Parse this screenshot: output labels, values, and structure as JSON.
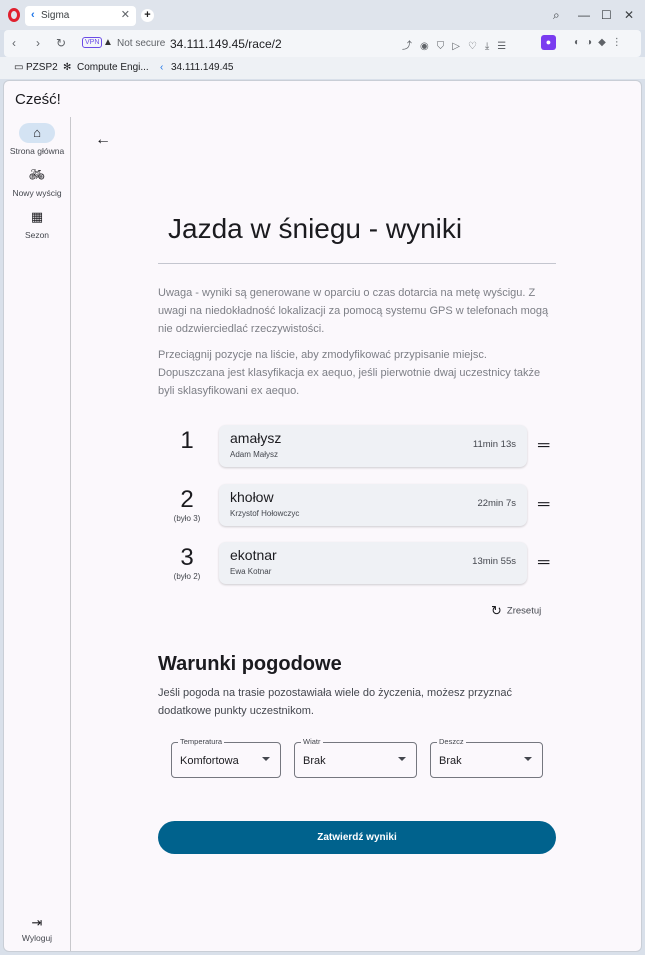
{
  "browser": {
    "tab_title": "Sigma",
    "new_tab": "+",
    "vpn_badge": "VPN",
    "not_secure": "Not secure",
    "url": "34.111.149.45/race/2",
    "bookmarks": [
      "PZSP2",
      "Compute Engi...",
      "34.111.149.45"
    ]
  },
  "app": {
    "greeting": "Cześć!",
    "rail": [
      {
        "icon": "home-icon",
        "label": "Strona główna"
      },
      {
        "icon": "bike-icon",
        "label": "Nowy wyścig"
      },
      {
        "icon": "calendar-icon",
        "label": "Sezon"
      }
    ],
    "logout_label": "Wyloguj"
  },
  "page": {
    "title": "Jazda w śniegu - wyniki",
    "note1": "Uwaga - wyniki są generowane w oparciu o czas dotarcia na metę wyścigu. Z uwagi na niedokładność lokalizacji za pomocą systemu GPS w telefonach mogą nie odzwierciedlać rzeczywistości.",
    "note2": "Przeciągnij pozycje na liście, aby zmodyfikować przypisanie miejsc. Dopuszczana jest klasyfikacja ex aequo, jeśli pierwotnie dwaj uczestnicy także byli sklasyfikowani ex aequo.",
    "results": [
      {
        "position": "1",
        "prev": "",
        "nick": "amałysz",
        "name": "Adam Małysz",
        "time": "11min 13s"
      },
      {
        "position": "2",
        "prev": "(było 3)",
        "nick": "khołow",
        "name": "Krzystof Hołowczyc",
        "time": "22min 7s"
      },
      {
        "position": "3",
        "prev": "(było 2)",
        "nick": "ekotnar",
        "name": "Ewa Kotnar",
        "time": "13min 55s"
      }
    ],
    "reset_label": "Zresetuj",
    "weather_title": "Warunki pogodowe",
    "weather_desc": "Jeśli pogoda na trasie pozostawiała wiele do życzenia, możesz przyznać dodatkowe punkty uczestnikom.",
    "selects": [
      {
        "label": "Temperatura",
        "value": "Komfortowa"
      },
      {
        "label": "Wiatr",
        "value": "Brak"
      },
      {
        "label": "Deszcz",
        "value": "Brak"
      }
    ],
    "submit_label": "Zatwierdź wyniki"
  }
}
